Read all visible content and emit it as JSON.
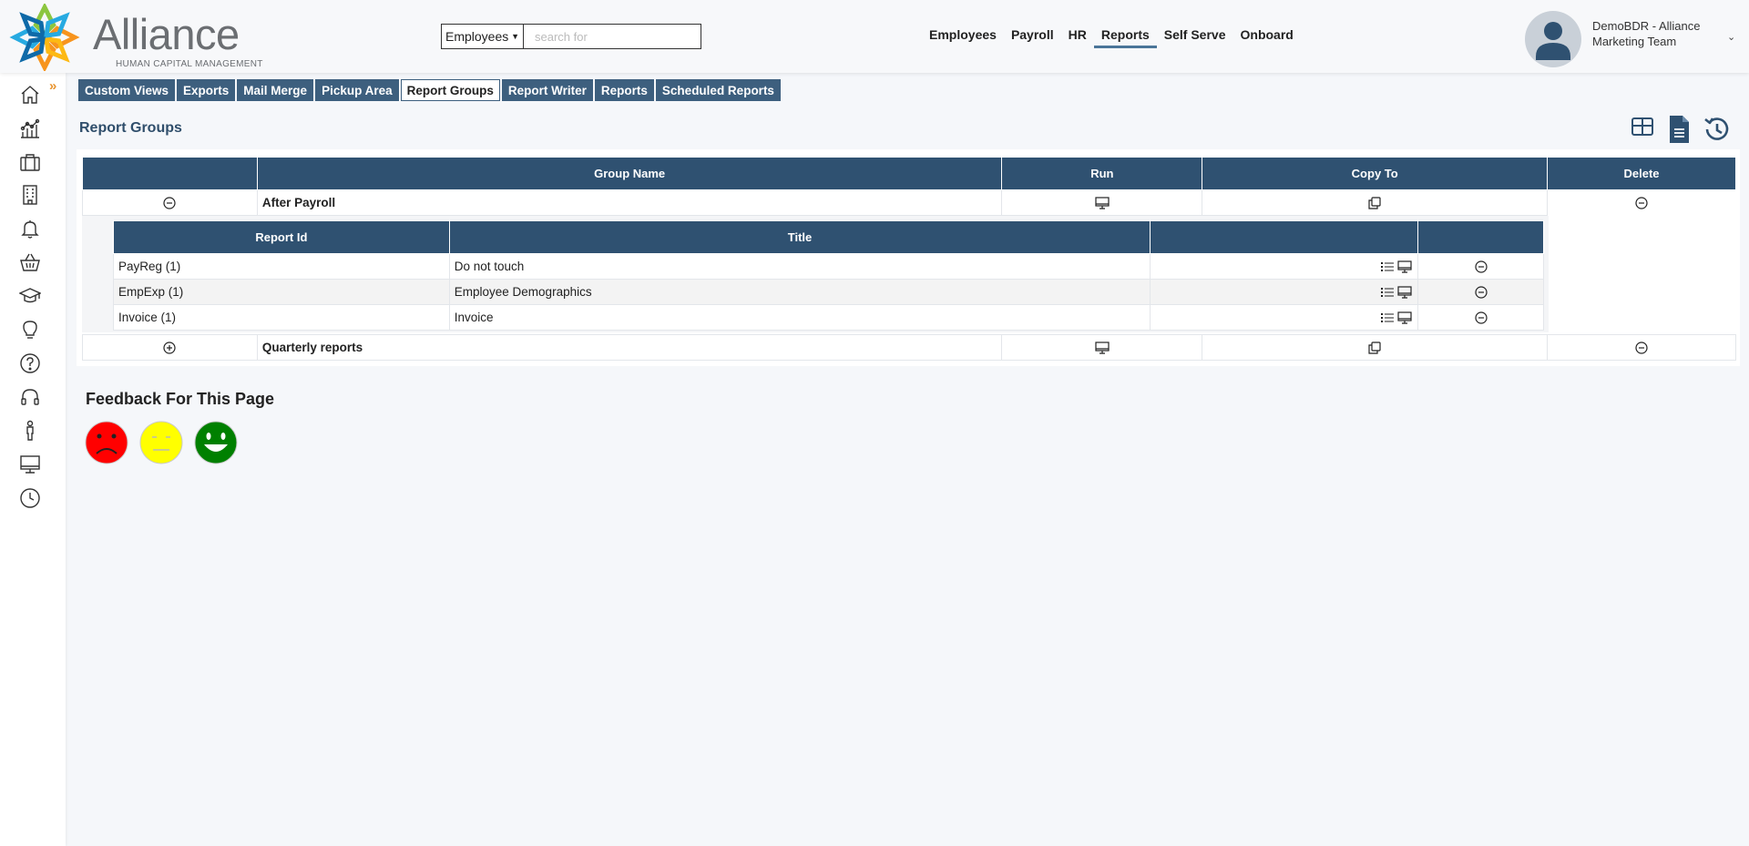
{
  "app": {
    "logo_word": "Alliance",
    "logo_sub": "HUMAN CAPITAL MANAGEMENT"
  },
  "search": {
    "scope": "Employees",
    "placeholder": "search for"
  },
  "topnav": [
    {
      "label": "Employees",
      "active": false
    },
    {
      "label": "Payroll",
      "active": false
    },
    {
      "label": "HR",
      "active": false
    },
    {
      "label": "Reports",
      "active": true
    },
    {
      "label": "Self Serve",
      "active": false
    },
    {
      "label": "Onboard",
      "active": false
    }
  ],
  "user": {
    "line1": "DemoBDR - Alliance",
    "line2": "Marketing Team"
  },
  "sidebar_icons": [
    "home-icon",
    "analytics-icon",
    "briefcase-icon",
    "building-icon",
    "bell-icon",
    "basket-icon",
    "graduation-cap-icon",
    "lightbulb-icon",
    "help-icon",
    "headset-icon",
    "person-icon",
    "monitor-icon",
    "clock-icon"
  ],
  "subtabs": [
    {
      "label": "Custom Views",
      "active": false
    },
    {
      "label": "Exports",
      "active": false
    },
    {
      "label": "Mail Merge",
      "active": false
    },
    {
      "label": "Pickup Area",
      "active": false
    },
    {
      "label": "Report Groups",
      "active": true
    },
    {
      "label": "Report Writer",
      "active": false
    },
    {
      "label": "Reports",
      "active": false
    },
    {
      "label": "Scheduled Reports",
      "active": false
    }
  ],
  "page": {
    "title": "Report Groups"
  },
  "groups_table": {
    "headers": [
      "",
      "Group Name",
      "Run",
      "Copy To",
      "Delete"
    ],
    "groups": [
      {
        "name": "After Payroll",
        "expanded": true
      },
      {
        "name": "Quarterly reports",
        "expanded": false
      }
    ]
  },
  "reports_table": {
    "headers": [
      "Report Id",
      "Title",
      "",
      ""
    ],
    "rows": [
      {
        "id": "PayReg (1)",
        "title": "Do not touch"
      },
      {
        "id": "EmpExp (1)",
        "title": "Employee Demographics"
      },
      {
        "id": "Invoice (1)",
        "title": "Invoice"
      }
    ]
  },
  "feedback": {
    "title": "Feedback For This Page",
    "colors": {
      "sad": "#ff0000",
      "neutral": "#ffff00",
      "happy": "#008000"
    }
  },
  "colors": {
    "header_blue": "#2f5171",
    "tab_blue": "#3d5f7e",
    "accent_orange": "#e8932e"
  }
}
